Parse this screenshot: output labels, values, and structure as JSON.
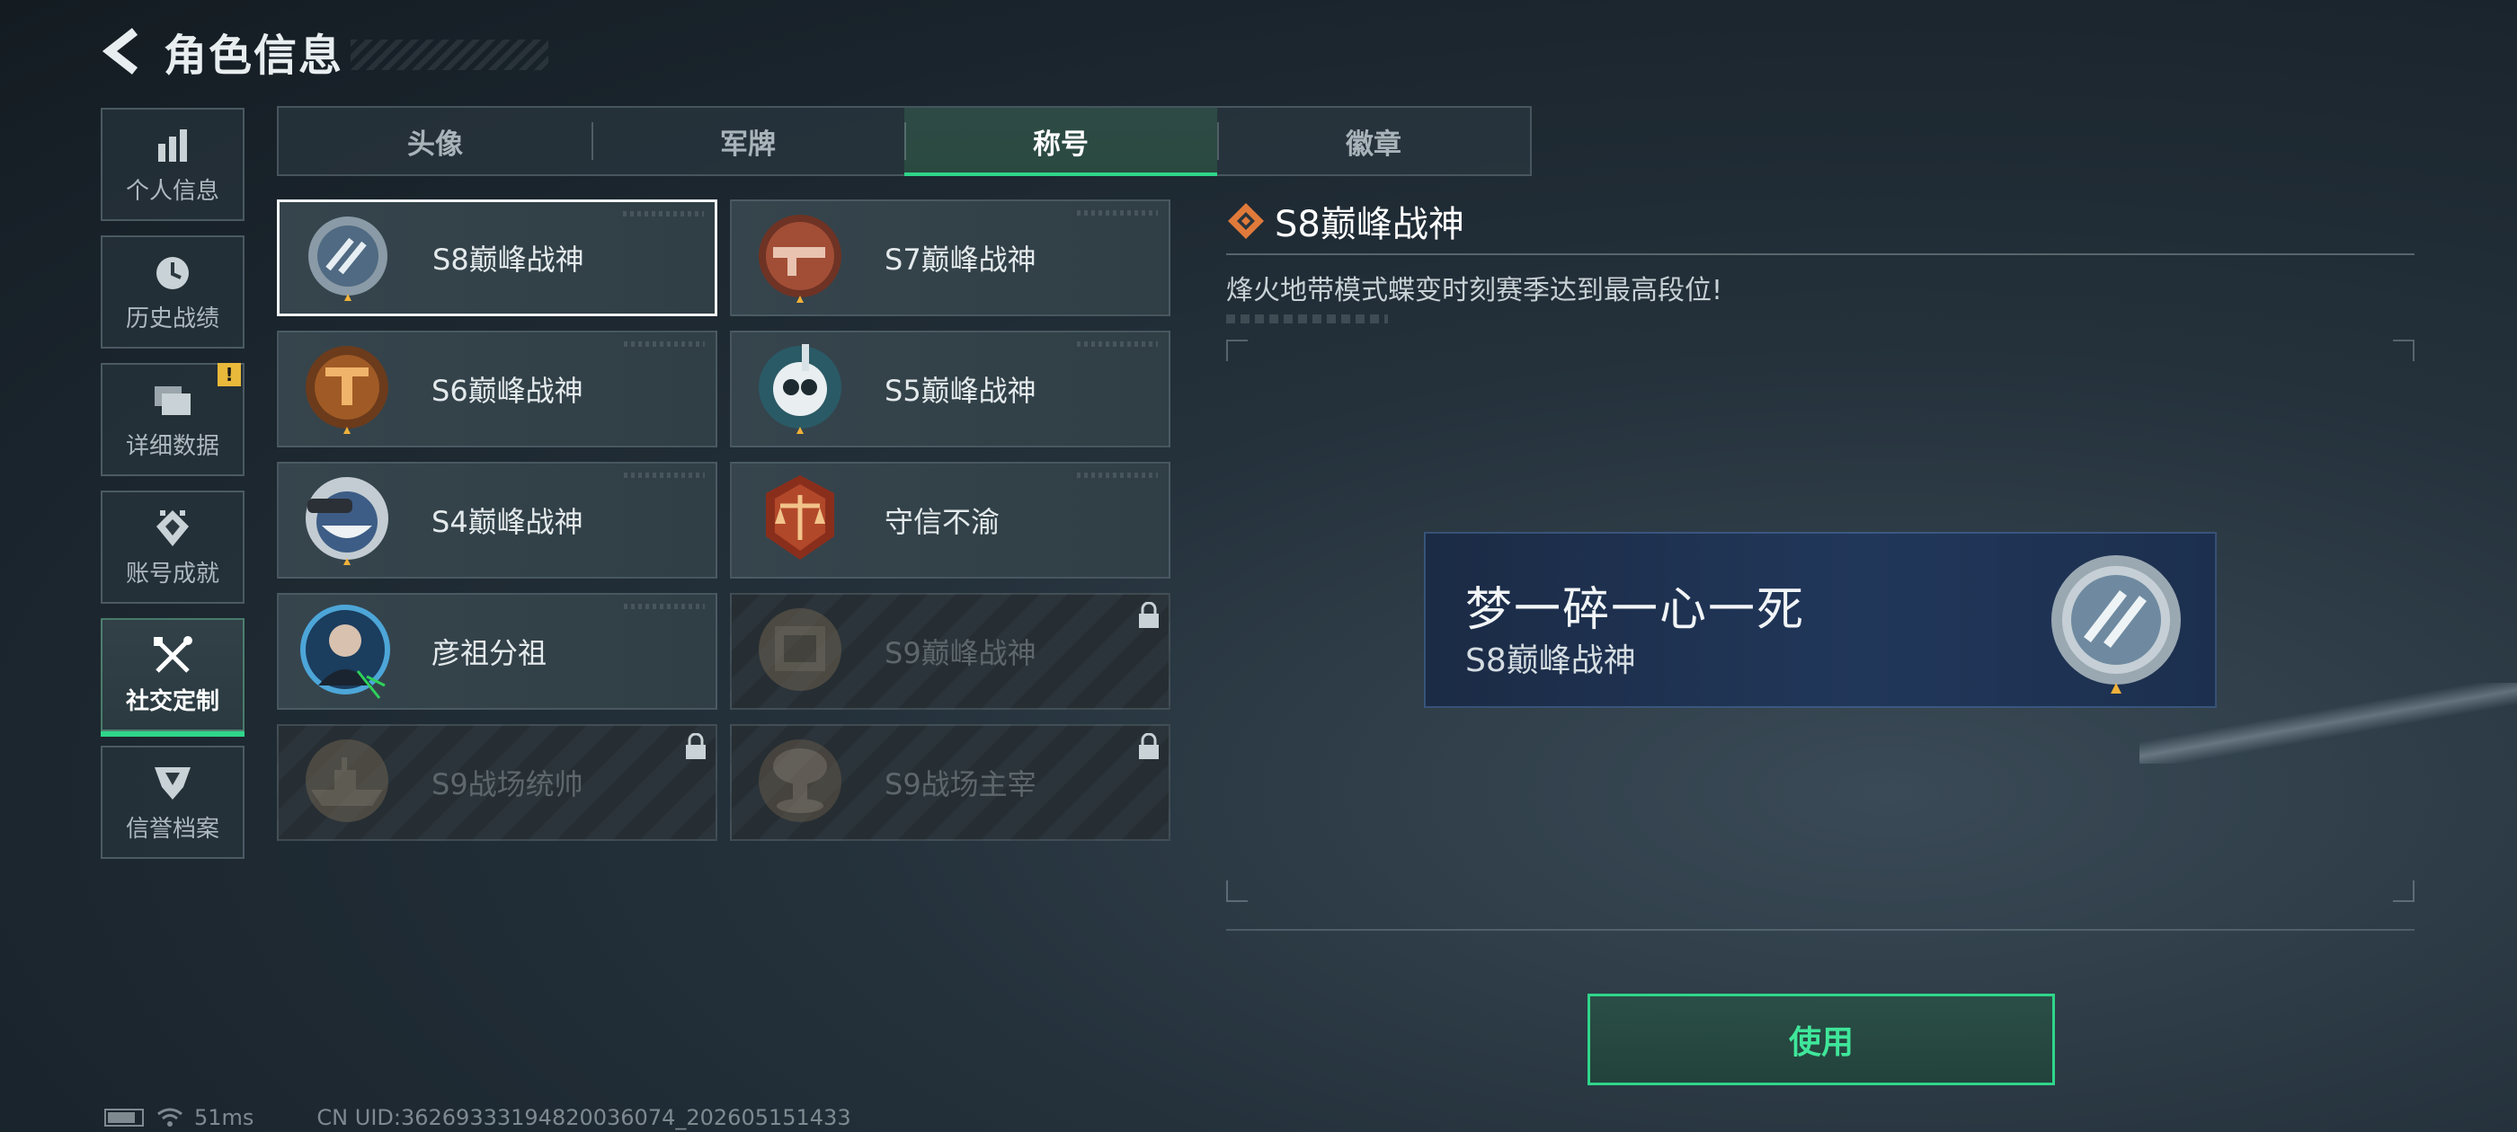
{
  "header": {
    "title": "角色信息"
  },
  "sidebar": {
    "items": [
      {
        "label": "个人信息",
        "icon": "bar-chart-icon",
        "active": false
      },
      {
        "label": "历史战绩",
        "icon": "clock-icon",
        "active": false
      },
      {
        "label": "详细数据",
        "icon": "folder-icon",
        "active": false,
        "badge": "!"
      },
      {
        "label": "账号成就",
        "icon": "achievement-icon",
        "active": false
      },
      {
        "label": "社交定制",
        "icon": "tools-icon",
        "active": true
      },
      {
        "label": "信誉档案",
        "icon": "shield-badge-icon",
        "active": false
      }
    ]
  },
  "tabs": [
    {
      "label": "头像",
      "active": false
    },
    {
      "label": "军牌",
      "active": false
    },
    {
      "label": "称号",
      "active": true
    },
    {
      "label": "徽章",
      "active": false
    }
  ],
  "titles": [
    {
      "name": "S8巅峰战神",
      "locked": false,
      "selected": true,
      "emblem": "s8-emblem-icon"
    },
    {
      "name": "S7巅峰战神",
      "locked": false,
      "selected": false,
      "emblem": "s7-emblem-icon"
    },
    {
      "name": "S6巅峰战神",
      "locked": false,
      "selected": false,
      "emblem": "s6-emblem-icon"
    },
    {
      "name": "S5巅峰战神",
      "locked": false,
      "selected": false,
      "emblem": "s5-emblem-icon"
    },
    {
      "name": "S4巅峰战神",
      "locked": false,
      "selected": false,
      "emblem": "s4-emblem-icon"
    },
    {
      "name": "守信不渝",
      "locked": false,
      "selected": false,
      "emblem": "scales-emblem-icon"
    },
    {
      "name": "彦祖分祖",
      "locked": false,
      "selected": false,
      "emblem": "portrait-emblem-icon"
    },
    {
      "name": "S9巅峰战神",
      "locked": true,
      "selected": false,
      "emblem": "s9-emblem-icon"
    },
    {
      "name": "S9战场统帅",
      "locked": true,
      "selected": false,
      "emblem": "ship-emblem-icon"
    },
    {
      "name": "S9战场主宰",
      "locked": true,
      "selected": false,
      "emblem": "mushroom-cloud-emblem-icon"
    }
  ],
  "detail": {
    "title": "S8巅峰战神",
    "description": "烽火地带模式蝶变时刻赛季达到最高段位!"
  },
  "preview": {
    "player_name": "梦一碎一心一死",
    "title": "S8巅峰战神"
  },
  "use_button": {
    "label": "使用"
  },
  "status_bar": {
    "ping": "51ms",
    "uid": "CN UID:3626933319482003607​4_202605151433"
  },
  "colors": {
    "accent": "#2fd68a",
    "warning": "#e8b93a",
    "title_diamond": "#e07a3a"
  }
}
